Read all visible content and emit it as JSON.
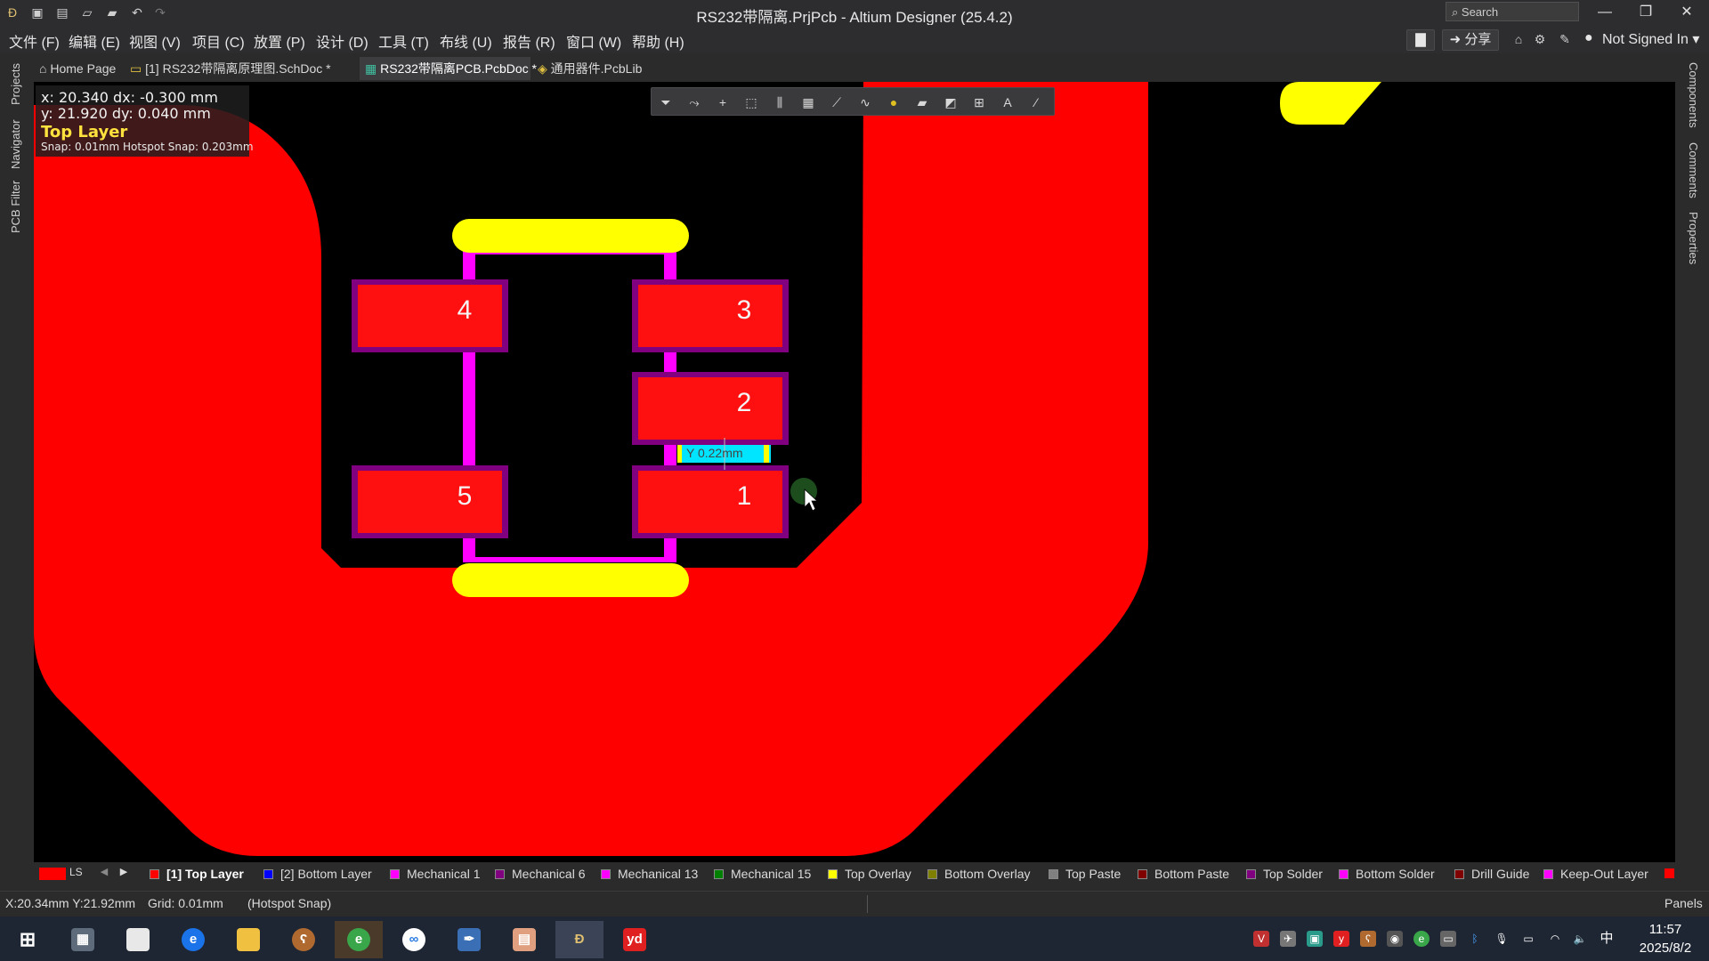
{
  "window": {
    "title": "RS232带隔离.PrjPcb - Altium Designer (25.4.2)",
    "search_placeholder": "Search",
    "minimize": "—",
    "restore": "❐",
    "close": "✕"
  },
  "menu": {
    "items": [
      "文件 (F)",
      "编辑 (E)",
      "视图 (V)",
      "项目 (C)",
      "放置 (P)",
      "设计 (D)",
      "工具 (T)",
      "布线 (U)",
      "报告 (R)",
      "窗口 (W)",
      "帮助 (H)"
    ],
    "share": "➜ 分享",
    "account": "Not Signed In ▾"
  },
  "tabs": [
    {
      "label": "Home Page",
      "icon": "home-icon"
    },
    {
      "label": "[1] RS232带隔离原理图.SchDoc *",
      "icon": "schematic-icon"
    },
    {
      "label": "RS232带隔离PCB.PcbDoc *",
      "icon": "pcb-icon",
      "active": true
    },
    {
      "label": "通用器件.PcbLib",
      "icon": "library-icon"
    }
  ],
  "left_panels": [
    "Projects",
    "Navigator",
    "PCB Filter"
  ],
  "right_panels": [
    "Components",
    "Comments",
    "Properties"
  ],
  "hud": {
    "line1": "x: 20.340   dx: -0.300 mm",
    "line2": "y: 21.920   dy:  0.040 mm",
    "layer": "Top Layer",
    "snap": "Snap: 0.01mm Hotspot Snap: 0.203mm"
  },
  "activebar_icons": [
    "filter-icon",
    "route-icon",
    "cross-icon",
    "select-rect-icon",
    "align-icon",
    "component-icon",
    "interactive-route-icon",
    "length-tune-icon",
    "pin-icon",
    "polygon-icon",
    "keepout-icon",
    "dimension-icon",
    "text-icon",
    "line-icon"
  ],
  "pcb": {
    "pads": [
      "4",
      "3",
      "2",
      "5",
      "1"
    ],
    "measure_label": "Y  0.22mm",
    "colors": {
      "copper": "#ff0000",
      "pad": "#ff1010",
      "pad_border": "#800080",
      "track": "#ff00ff",
      "overlay": "#ffff00",
      "measure_bg": "#00e5ff"
    }
  },
  "layer_bar": {
    "ls_label": "LS",
    "layers": [
      {
        "label": "[1] Top Layer",
        "color": "#ff0000",
        "active": true
      },
      {
        "label": "[2] Bottom Layer",
        "color": "#0000ff"
      },
      {
        "label": "Mechanical 1",
        "color": "#ff00ff"
      },
      {
        "label": "Mechanical 6",
        "color": "#800080"
      },
      {
        "label": "Mechanical 13",
        "color": "#ff00ff"
      },
      {
        "label": "Mechanical 15",
        "color": "#008000"
      },
      {
        "label": "Top Overlay",
        "color": "#ffff00"
      },
      {
        "label": "Bottom Overlay",
        "color": "#808000"
      },
      {
        "label": "Top Paste",
        "color": "#808080"
      },
      {
        "label": "Bottom Paste",
        "color": "#800000"
      },
      {
        "label": "Top Solder",
        "color": "#800080"
      },
      {
        "label": "Bottom Solder",
        "color": "#ff00ff"
      },
      {
        "label": "Drill Guide",
        "color": "#800000"
      },
      {
        "label": "Keep-Out Layer",
        "color": "#ff00ff"
      }
    ]
  },
  "status": {
    "coords": "X:20.34mm Y:21.92mm",
    "grid": "Grid: 0.01mm",
    "snap": "(Hotspot Snap)",
    "panels": "Panels"
  },
  "taskbar": {
    "apps": [
      "start-icon",
      "calculator-icon",
      "notepad-icon",
      "edge-icon",
      "explorer-icon",
      "bear-app-icon",
      "browser-icon",
      "baidu-cloud-icon",
      "feather-app-icon",
      "powerpoint-icon",
      "altium-icon",
      "youdao-icon"
    ],
    "youdao_label": "yd",
    "ime": "中",
    "time": "11:57",
    "date": "2025/8/2"
  }
}
